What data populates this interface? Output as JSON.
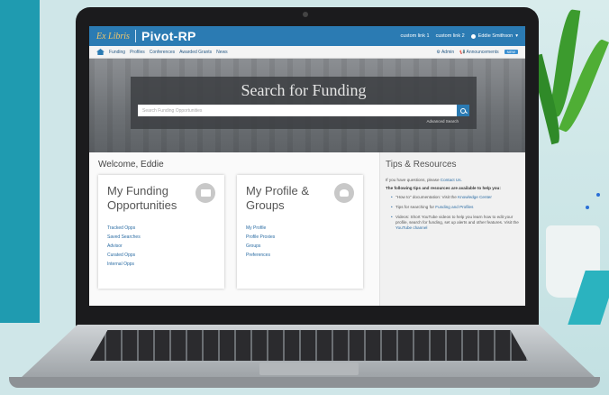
{
  "app": {
    "logo_text": "Ex Libris",
    "title": "Pivot-RP"
  },
  "header": {
    "links": [
      "custom link 1",
      "custom link 2"
    ],
    "user_name": "Eddie Smithson"
  },
  "nav": {
    "items": [
      "Funding",
      "Profiles",
      "Conferences",
      "Awarded Grants",
      "News"
    ],
    "admin_label": "Admin",
    "announcements_label": "Announcements",
    "new_badge": "NEW"
  },
  "search": {
    "title": "Search for Funding",
    "placeholder": "Search Funding Opportunities",
    "advanced_label": "Advanced Search"
  },
  "welcome": "Welcome, Eddie",
  "funding_card": {
    "title": "My Funding Opportunities",
    "links": [
      "Tracked Opps",
      "Saved Searches",
      "Advisor",
      "Curated Opps",
      "Internal Opps"
    ]
  },
  "profile_card": {
    "title": "My Profile & Groups",
    "links": [
      "My Profile",
      "Profile Proxies",
      "Groups",
      "Preferences"
    ]
  },
  "tips": {
    "title": "Tips & Resources",
    "intro_text": "If you have questions, please",
    "intro_link": "Contact Us.",
    "lead": "The following tips and resources are available to help you:",
    "items": [
      {
        "text": "\"How to\" documentation: Visit the",
        "link": "Knowledge Center"
      },
      {
        "text": "Tips for searching for",
        "link": "Funding and Profiles"
      },
      {
        "text": "Videos: Short YouTube videos to help you learn how to edit your profile, search for funding, set up alerts and other features. Visit the",
        "link": "YouTube channel"
      }
    ]
  },
  "colors": {
    "header_blue": "#2b7bb3",
    "link_blue": "#2b6ca3",
    "page_teal": "#1f9bb0"
  }
}
